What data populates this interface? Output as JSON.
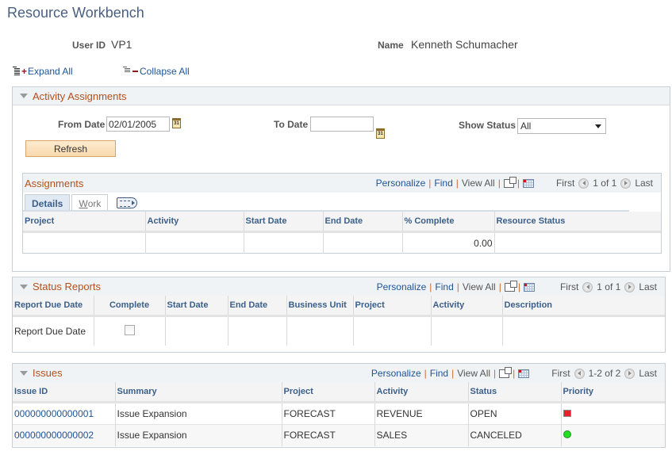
{
  "page": {
    "title": "Resource Workbench",
    "user_id_label": "User ID",
    "user_id_value": "VP1",
    "name_label": "Name",
    "name_value": "Kenneth Schumacher",
    "expand_all": "Expand All",
    "collapse_all": "Collapse All"
  },
  "grid_nav": {
    "personalize": "Personalize",
    "find": "Find",
    "view_all": "View All",
    "separator": "|",
    "first": "First",
    "last": "Last"
  },
  "activity": {
    "title": "Activity Assignments",
    "from_date_label": "From Date",
    "from_date_value": "02/01/2005",
    "to_date_label": "To Date",
    "to_date_value": "",
    "calendar_glyph": "31",
    "show_status_label": "Show Status",
    "show_status_value": "All",
    "refresh_label": "Refresh",
    "assignments": {
      "title": "Assignments",
      "page_count": "1 of 1",
      "tabs": [
        {
          "label": "Details",
          "active": true
        },
        {
          "label_first": "W",
          "label_rest": "ork",
          "active": false
        }
      ],
      "columns": [
        "Project",
        "Activity",
        "Start Date",
        "End Date",
        "% Complete",
        "Resource Status"
      ],
      "rows": [
        {
          "project": "",
          "activity": "",
          "start_date": "",
          "end_date": "",
          "percent_complete": "0.00",
          "resource_status": ""
        }
      ]
    }
  },
  "status_reports": {
    "title": "Status Reports",
    "page_count": "1 of 1",
    "columns": [
      "Report Due Date",
      "Complete",
      "Start Date",
      "End Date",
      "Business Unit",
      "Project",
      "Activity",
      "Description"
    ],
    "rows": [
      {
        "report_due_date": "Report Due Date",
        "complete": false,
        "start_date": "",
        "end_date": "",
        "business_unit": "",
        "project": "",
        "activity": "",
        "description": ""
      }
    ]
  },
  "issues": {
    "title": "Issues",
    "page_count": "1-2 of 2",
    "columns": [
      "Issue ID",
      "Summary",
      "Project",
      "Activity",
      "Status",
      "Priority"
    ],
    "rows": [
      {
        "issue_id": "000000000000001",
        "summary": "Issue Expansion",
        "project": "FORECAST",
        "activity": "REVENUE",
        "status": "OPEN",
        "priority": "high",
        "priority_color": "#e8202a"
      },
      {
        "issue_id": "000000000000002",
        "summary": "Issue Expansion",
        "project": "FORECAST",
        "activity": "SALES",
        "status": "CANCELED",
        "priority": "low",
        "priority_color": "#1ee01e"
      }
    ]
  }
}
